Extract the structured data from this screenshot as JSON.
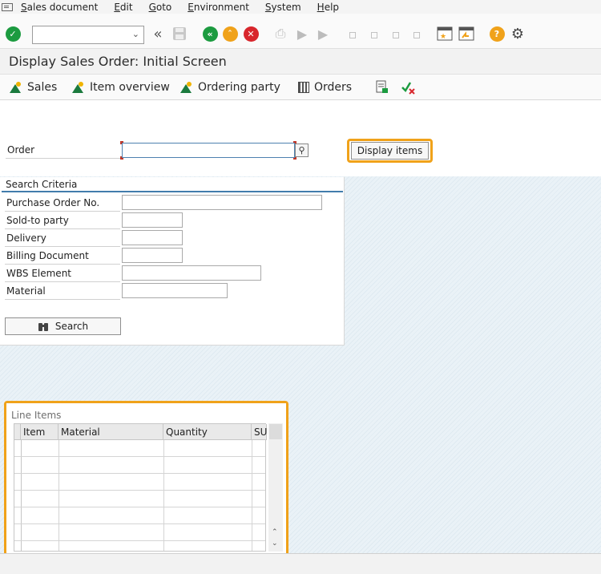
{
  "menu": [
    "Sales document",
    "Edit",
    "Goto",
    "Environment",
    "System",
    "Help"
  ],
  "command_field": {
    "value": ""
  },
  "title": "Display Sales Order: Initial Screen",
  "app_toolbar": {
    "sales": "Sales",
    "item_overview": "Item overview",
    "ordering_party": "Ordering party",
    "orders": "Orders"
  },
  "order": {
    "label": "Order",
    "value": ""
  },
  "display_items_label": "Display items",
  "search_criteria": {
    "title": "Search Criteria",
    "fields": [
      {
        "label": "Purchase Order No.",
        "value": ""
      },
      {
        "label": "Sold-to party",
        "value": ""
      },
      {
        "label": "Delivery",
        "value": ""
      },
      {
        "label": "Billing Document",
        "value": ""
      },
      {
        "label": "WBS Element",
        "value": ""
      },
      {
        "label": "Material",
        "value": ""
      }
    ],
    "search_label": "Search"
  },
  "line_items": {
    "title": "Line Items",
    "columns": [
      "Item",
      "Material",
      "Quantity",
      "SU"
    ]
  },
  "colors": {
    "highlight": "#f0a21a",
    "accent": "#427cac"
  }
}
